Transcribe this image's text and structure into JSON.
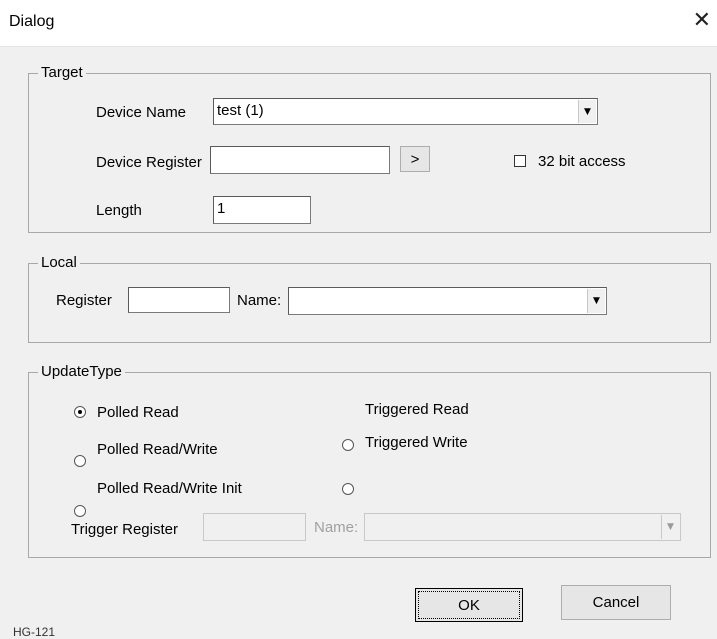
{
  "window": {
    "title": "Dialog",
    "close_icon": "✕"
  },
  "target": {
    "legend": "Target",
    "device_name_label": "Device Name",
    "device_name_value": "test (1)",
    "device_register_label": "Device Register",
    "device_register_value": "",
    "browse_button_label": ">",
    "bit_access_label": "32 bit access",
    "bit_access_checked": false,
    "length_label": "Length",
    "length_value": "1"
  },
  "local": {
    "legend": "Local",
    "register_label": "Register",
    "register_value": "",
    "name_label": "Name:",
    "name_value": ""
  },
  "update_type": {
    "legend": "UpdateType",
    "options": [
      {
        "label": "Polled Read",
        "checked": true
      },
      {
        "label": "Polled Read/Write",
        "checked": false
      },
      {
        "label": "Polled Read/Write Init",
        "checked": false
      },
      {
        "label": "Triggered Read",
        "checked": false
      },
      {
        "label": "Triggered Write",
        "checked": false
      }
    ],
    "trigger_register_label": "Trigger Register",
    "trigger_register_value": "",
    "trigger_name_label": "Name:",
    "trigger_name_value": ""
  },
  "buttons": {
    "ok_label": "OK",
    "cancel_label": "Cancel"
  },
  "footer": {
    "label": "HG-121"
  }
}
